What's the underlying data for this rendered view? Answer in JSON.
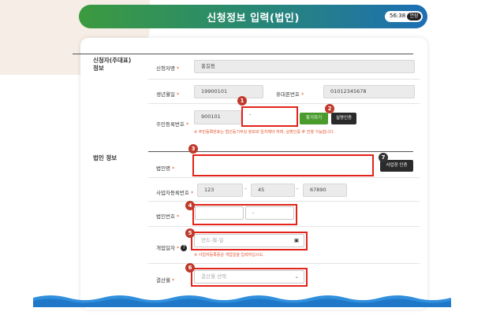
{
  "header": {
    "title": "신청정보 입력(법인)",
    "timer": "56:38",
    "extend_label": "연장"
  },
  "applicant": {
    "section_title_line1": "신청자(주대표)",
    "section_title_line2": "정보",
    "name_label": "신청자명",
    "name_value": "홍길동",
    "birth_label": "생년월일",
    "birth_value": "19900101",
    "phone_label": "휴대폰번호",
    "phone_value": "01012345678",
    "rrn_label": "주민등록번호",
    "rrn_front": "900101",
    "rrn_back": "-",
    "find_button": "찾기하기",
    "verify_button": "실명인증",
    "notice": "※ 주민등록번호는 법인등기부상 정보와 일치해야 하며, 실명인증 후 진행 가능합니다."
  },
  "corporation": {
    "section_title": "법인 정보",
    "name_label": "법인명",
    "name_value": "",
    "lookup_button": "사업장 인증",
    "bizno_label": "사업자등록번호",
    "bizno_1": "123",
    "bizno_2": "45",
    "bizno_3": "67890",
    "corpno_label": "법인번호",
    "corpno_1": "",
    "corpno_2": "-",
    "founded_label": "개업일자",
    "founded_placeholder": "연도-월-일",
    "founded_notice": "※ 사업자등록증상 개업일을 입력하십시오.",
    "settle_label": "결산월",
    "settle_placeholder": "결산월 선택"
  },
  "markers": [
    "1",
    "2",
    "3",
    "4",
    "5",
    "6",
    "7"
  ],
  "colors": {
    "header_start": "#3b9a3f",
    "header_end": "#1c6fb4",
    "highlight": "#e2231a",
    "notice": "#e5542b",
    "wave": "#2f8fdd"
  }
}
